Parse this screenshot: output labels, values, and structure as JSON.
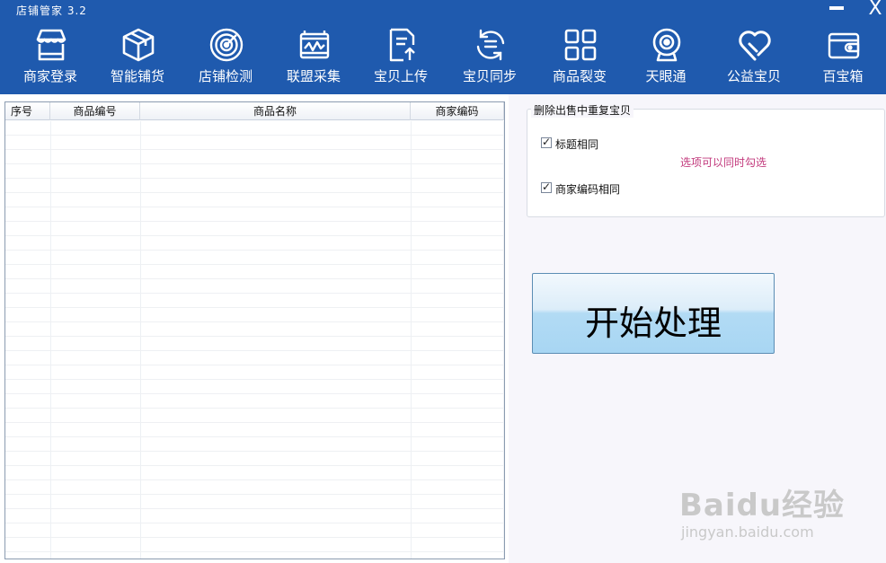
{
  "window": {
    "title": "店铺管家   3.2",
    "minimize_glyph": "",
    "close_glyph": "X"
  },
  "toolbar": {
    "items": [
      {
        "label": "商家登录",
        "icon": "storefront-icon"
      },
      {
        "label": "智能铺货",
        "icon": "box-icon"
      },
      {
        "label": "店铺检测",
        "icon": "radar-icon"
      },
      {
        "label": "联盟采集",
        "icon": "chart-frame-icon"
      },
      {
        "label": "宝贝上传",
        "icon": "document-upload-icon"
      },
      {
        "label": "宝贝同步",
        "icon": "sync-icon"
      },
      {
        "label": "商品裂变",
        "icon": "grid-icon"
      },
      {
        "label": "天眼通",
        "icon": "webcam-icon"
      },
      {
        "label": "公益宝贝",
        "icon": "heart-icon"
      },
      {
        "label": "百宝箱",
        "icon": "wallet-icon"
      }
    ]
  },
  "table": {
    "columns": [
      "序号",
      "商品编号",
      "商品名称",
      "商家编码"
    ],
    "rows": []
  },
  "options": {
    "group_title": "删除出售中重复宝贝",
    "title_same": {
      "label": "标题相同",
      "checked": true
    },
    "hint": "选项可以同时勾选",
    "code_same": {
      "label": "商家编码相同",
      "checked": true
    }
  },
  "start_button": {
    "label": "开始处理"
  },
  "watermark": {
    "logo": "Baidu经验",
    "url": "jingyan.baidu.com"
  },
  "colors": {
    "header": "#1f5aae",
    "hint": "#c2397c",
    "button_top": "#f2f8fd",
    "button_bottom": "#a8d6f3"
  }
}
